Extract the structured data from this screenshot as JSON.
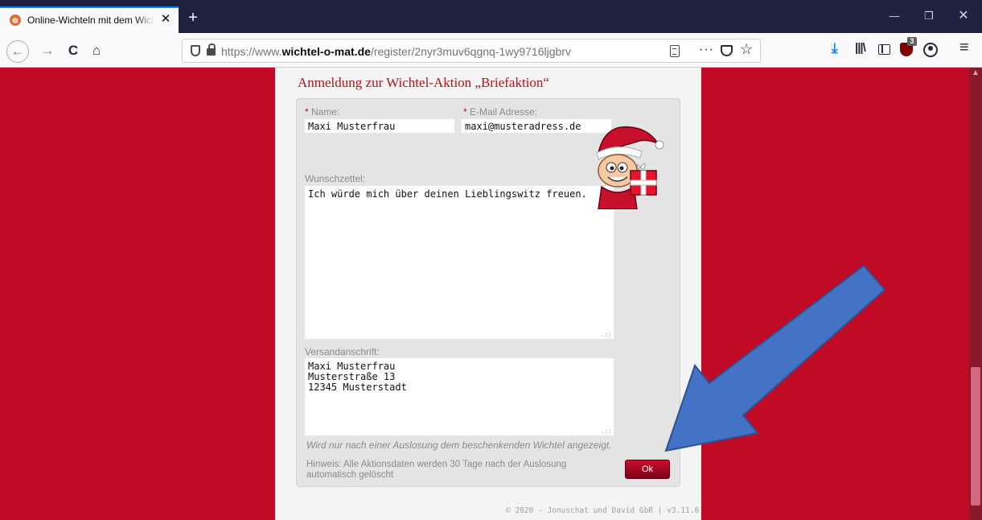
{
  "browser": {
    "tab": {
      "title": "Online-Wichteln mit dem Wichtel-O-Mat",
      "close": "✕"
    },
    "new_tab": "+",
    "window_controls": {
      "minimize": "—",
      "maximize": "❐",
      "close": "✕"
    },
    "nav": {
      "back": "←",
      "forward": "→",
      "reload": "C",
      "home": "⌂"
    },
    "url": {
      "prefix": "https://www.",
      "domain": "wichtel-o-mat.de",
      "path": "/register/2nyr3muv6qgnq-1wy9716ljgbrv"
    },
    "url_actions": {
      "more": "···",
      "star": "☆"
    },
    "toolbar": {
      "download": "⤓",
      "library": "|||\\",
      "ublock_badge": "3",
      "menu": "≡"
    }
  },
  "form": {
    "title": "Anmeldung zur Wichtel-Aktion „Briefaktion“",
    "required_mark": "*",
    "name_label": " Name:",
    "name_value": "Maxi Musterfrau",
    "email_label": " E-Mail Adresse:",
    "email_value": "maxi@musteradress.de",
    "wish_label": "Wunschzettel:",
    "wish_value": "Ich würde mich über deinen Lieblingswitz freuen.",
    "address_label": "Versandanschrift:",
    "address_value": "Maxi Musterfrau\nMusterstraße 13\n12345 Musterstadt",
    "address_hint": "Wird nur nach einer Auslosung dem beschenkenden Wichtel angezeigt.",
    "note": "Hinweis: Alle Aktionsdaten werden 30 Tage nach der Auslosung automatisch gelöscht",
    "ok_label": "Ok"
  },
  "footer": "© 2020 - Jonuschat und David GbR | v3.11.6",
  "scrollbar": {
    "up": "▲"
  },
  "colors": {
    "page_background": "#c00a26",
    "title": "#b5121b",
    "arrow": "#4472c4"
  }
}
